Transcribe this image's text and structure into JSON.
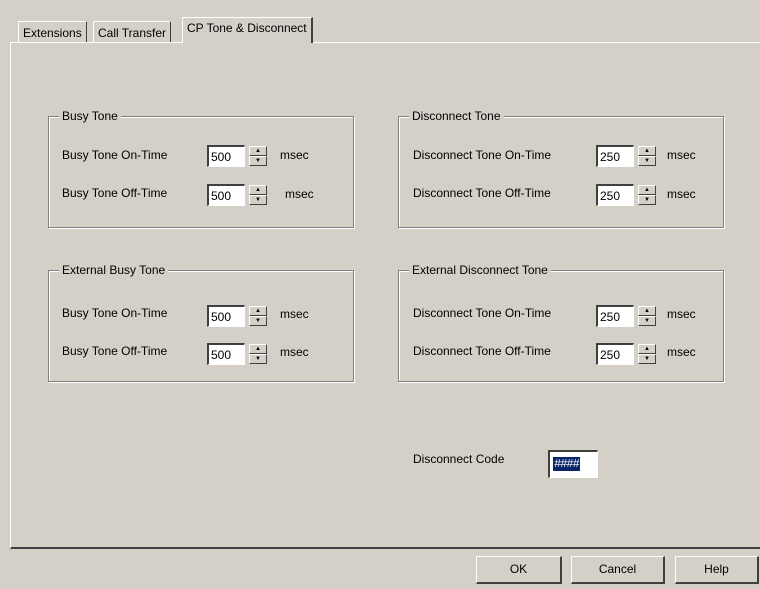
{
  "tabs": [
    {
      "label": "Extensions",
      "active": false
    },
    {
      "label": "Call Transfer",
      "active": false
    },
    {
      "label": "CP Tone & Disconnect",
      "active": true
    }
  ],
  "groups": {
    "busy_tone": {
      "title": "Busy Tone",
      "on_label": "Busy Tone On-Time",
      "on_value": "500",
      "off_label": "Busy Tone Off-Time",
      "off_value": "500",
      "unit": "msec"
    },
    "disconnect_tone": {
      "title": "Disconnect Tone",
      "on_label": "Disconnect Tone On-Time",
      "on_value": "250",
      "off_label": "Disconnect Tone Off-Time",
      "off_value": "250",
      "unit": "msec"
    },
    "external_busy_tone": {
      "title": "External Busy Tone",
      "on_label": "Busy Tone On-Time",
      "on_value": "500",
      "off_label": "Busy Tone Off-Time",
      "off_value": "500",
      "unit": "msec"
    },
    "external_disconnect_tone": {
      "title": "External Disconnect Tone",
      "on_label": "Disconnect Tone On-Time",
      "on_value": "250",
      "off_label": "Disconnect Tone Off-Time",
      "off_value": "250",
      "unit": "msec"
    }
  },
  "disconnect_code": {
    "label": "Disconnect Code",
    "value": "####"
  },
  "buttons": {
    "ok": "OK",
    "cancel": "Cancel",
    "help": "Help"
  },
  "icons": {
    "spin_up": "▲",
    "spin_down": "▼"
  },
  "colors": {
    "face": "#d4d0c8",
    "highlight": "#0a246a"
  }
}
